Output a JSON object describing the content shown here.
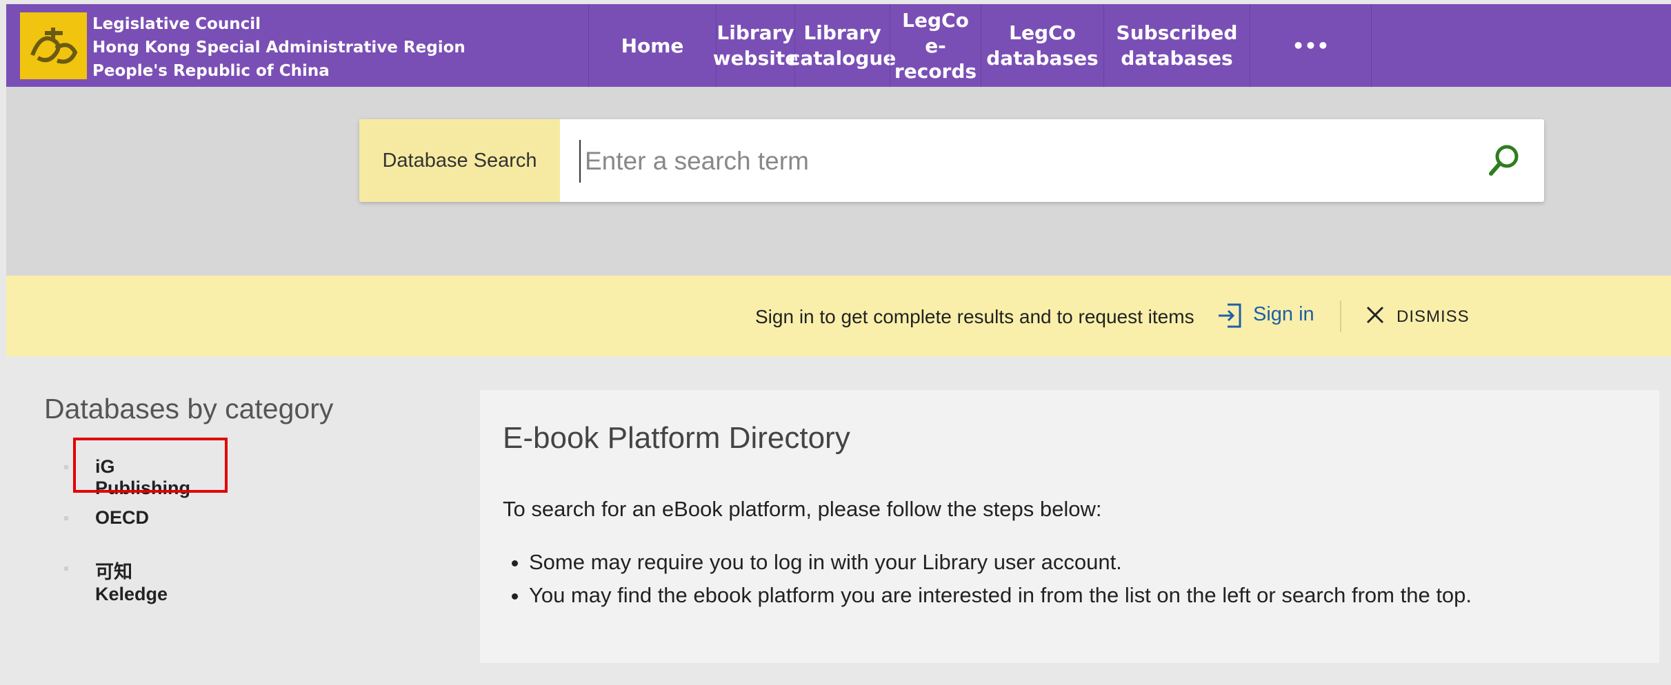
{
  "header": {
    "org_lines": [
      "Legislative Council",
      "Hong Kong Special Administrative Region",
      "People's Republic of China"
    ],
    "logo_icon": "legco-logo-icon",
    "nav": [
      {
        "label": "Home"
      },
      {
        "label": "Library\nwebsite"
      },
      {
        "label": "Library\ncatalogue"
      },
      {
        "label": "LegCo e-\nrecords"
      },
      {
        "label": "LegCo\ndatabases"
      },
      {
        "label": "Subscribed\ndatabases"
      },
      {
        "label": "•••"
      }
    ]
  },
  "search": {
    "scope_label": "Database Search",
    "placeholder": "Enter a search term",
    "value": "",
    "button_icon": "search-icon"
  },
  "banner": {
    "message": "Sign in to get complete results and to request items",
    "signin_label": "Sign in",
    "dismiss_label": "DISMISS"
  },
  "categories": {
    "title": "Databases by category",
    "items": [
      "iG Publishing",
      "OECD",
      "可知 Keledge"
    ],
    "highlighted": "iG Publishing"
  },
  "panel": {
    "title": "E-book Platform Directory",
    "intro": "To search for an eBook platform, please follow the steps below:",
    "bullets": [
      "Some may require you to log in with your Library user account.",
      "You may find the ebook platform you are interested in from the list on the left or search from the top."
    ]
  },
  "colors": {
    "header_bg": "#7a4fb5",
    "search_band_bg": "#d7d7d7",
    "scope_bg": "#f6eaa2",
    "banner_bg": "#f9efaa",
    "link": "#1f5ea8",
    "search_icon": "#2e7d1e",
    "highlight_border": "#e20000"
  }
}
